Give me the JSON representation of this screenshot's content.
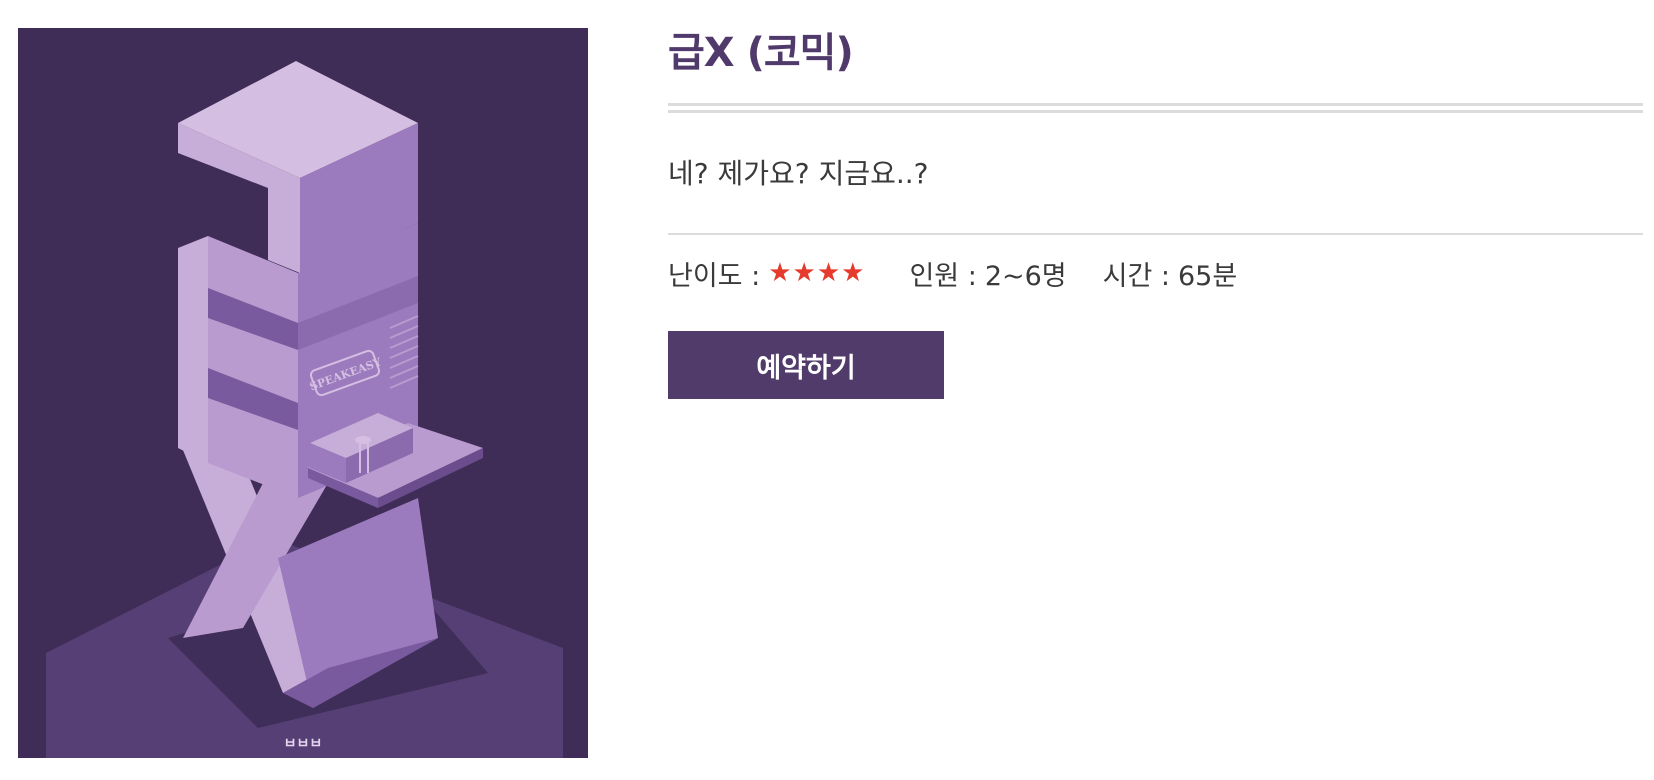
{
  "poster": {
    "logo_text": "SPEAKEASY",
    "brand_mark": "ㅂㅂㅂ",
    "colors": {
      "background": "#3f2d58",
      "light_face": "#c7aed8",
      "mid_face": "#9b7bbd",
      "dark_face": "#7a5a9e"
    }
  },
  "theme": {
    "title": "급X (코믹)",
    "tagline": "네? 제가요? 지금요..?",
    "difficulty_label": "난이도 :",
    "difficulty_stars": 4,
    "people_label": "인원 :",
    "people_value": "2~6명",
    "time_label": "시간 :",
    "time_value": "65분",
    "reserve_label": "예약하기"
  },
  "colors": {
    "accent": "#513b6b",
    "title": "#4f3a6b",
    "star": "#e53a2c",
    "rule": "#dcdcdc"
  }
}
